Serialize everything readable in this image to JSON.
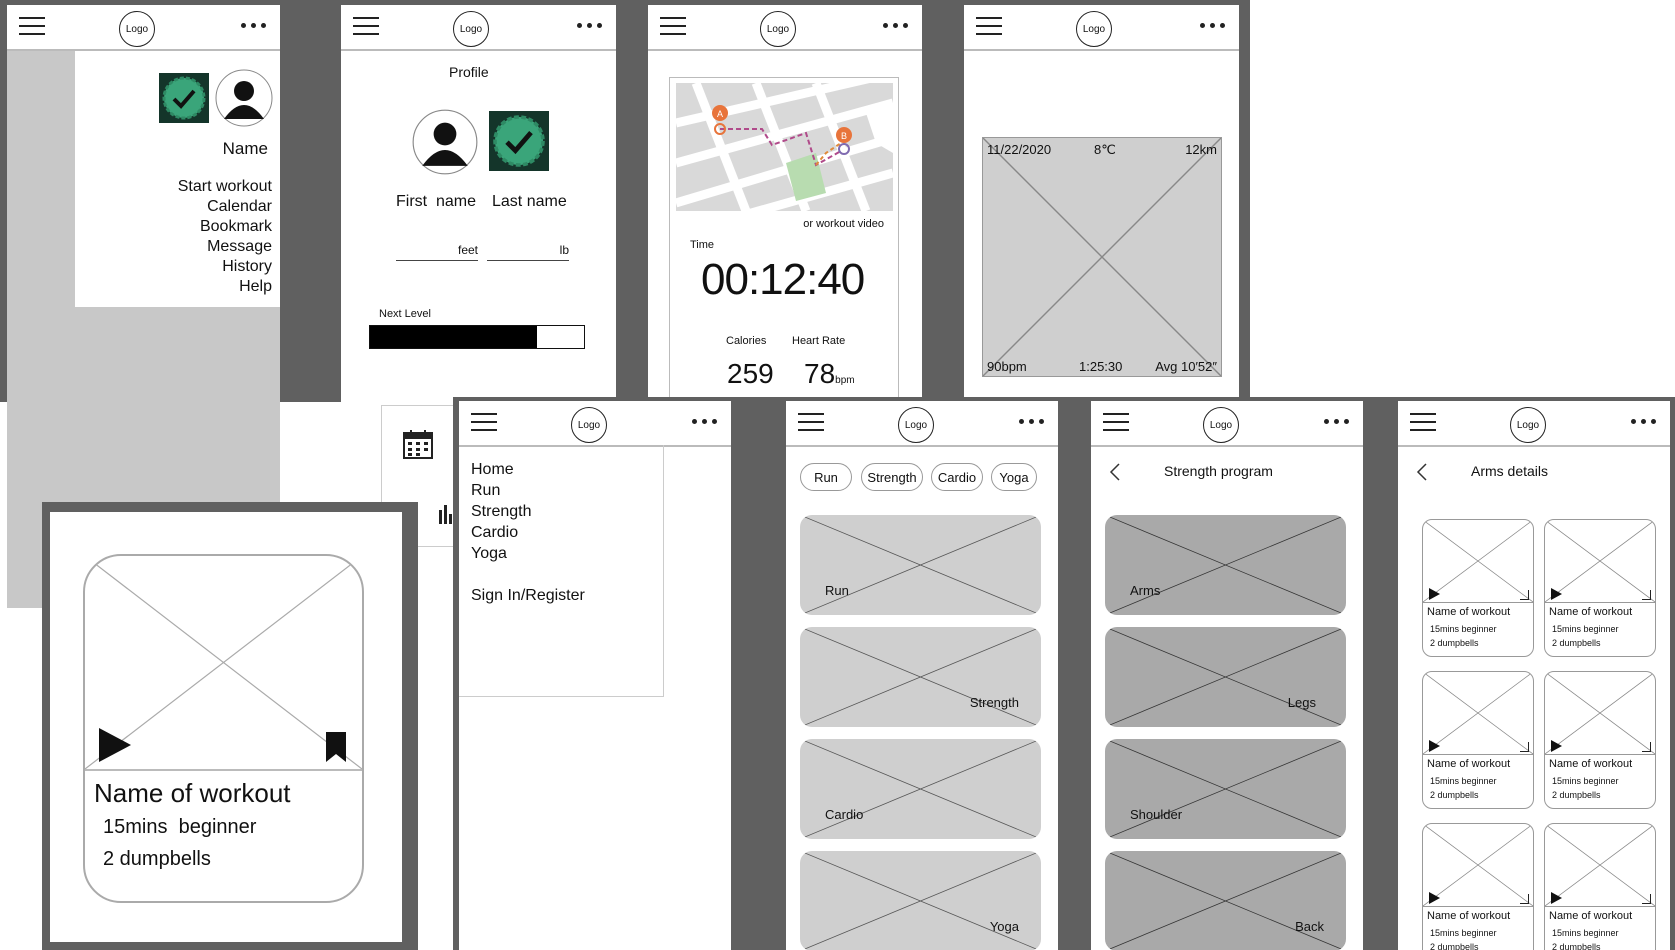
{
  "common": {
    "logo": "Logo"
  },
  "menu_screen": {
    "name": "Name",
    "items": [
      "Start workout",
      "Calendar",
      "Bookmark",
      "Message",
      "History",
      "Help"
    ]
  },
  "profile_screen": {
    "title": "Profile",
    "first_name": "First  name",
    "last_name": "Last name",
    "unit_height": "feet",
    "unit_weight": "lb",
    "next_level_label": "Next Level",
    "progress": 0.78
  },
  "tracking_screen": {
    "video_label": "or workout video",
    "time_label": "Time",
    "time_value": "00:12:40",
    "calories_label": "Calories",
    "calories_value": "259",
    "heart_label": "Heart Rate",
    "heart_value": "78",
    "heart_unit": "bpm"
  },
  "summary_screen": {
    "date": "11/22/2020",
    "temp": "8℃",
    "distance": "12km",
    "bpm": "90bpm",
    "duration": "1:25:30",
    "pace": "Avg 10′52″"
  },
  "nav_screen": {
    "items": [
      "Home",
      "Run",
      "Strength",
      "Cardio",
      "Yoga"
    ],
    "sign_in": "Sign In/Register"
  },
  "category_screen": {
    "pills": [
      "Run",
      "Strength",
      "Cardio",
      "Yoga"
    ],
    "cards": [
      "Run",
      "Strength",
      "Cardio",
      "Yoga"
    ]
  },
  "strength_screen": {
    "title": "Strength program",
    "cards": [
      "Arms",
      "Legs",
      "Shoulder",
      "Back"
    ]
  },
  "arms_screen": {
    "title": "Arms details",
    "workout_name": "Name of workout",
    "meta": "15mins  beginner",
    "equipment": "2 dumpbells"
  },
  "zoom_card": {
    "name": "Name of workout",
    "meta": "15mins  beginner",
    "equipment": "2 dumpbells"
  },
  "colors": {
    "badge_green": "#3aa57a",
    "badge_dark": "#14352a",
    "placeholder": "#cfcfcf",
    "placeholder_dark": "#a9a9a9",
    "frame": "#606060"
  }
}
